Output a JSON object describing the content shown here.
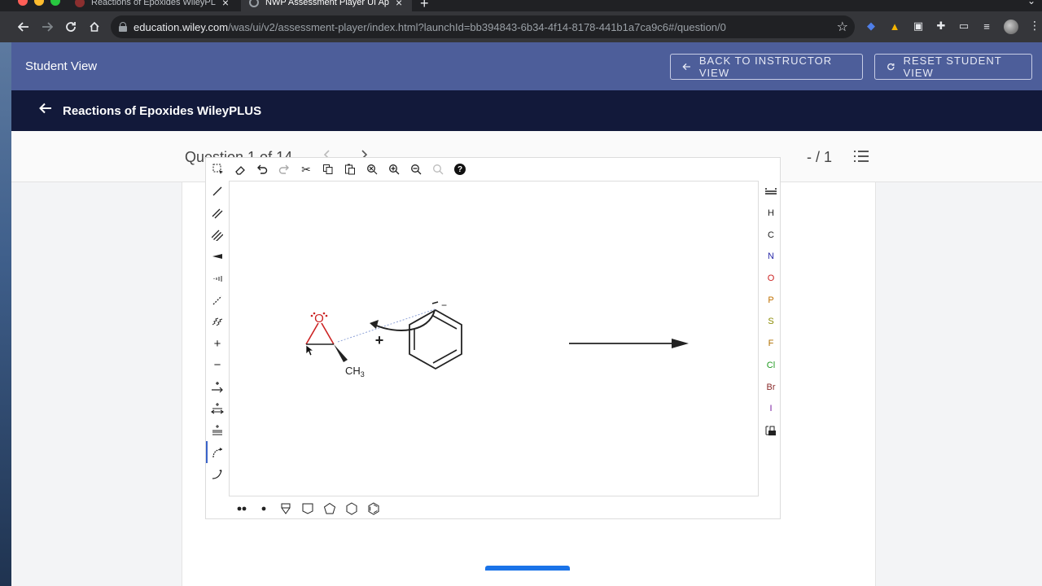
{
  "browser": {
    "tabs": [
      {
        "title": "Reactions of Epoxides WileyPL",
        "active": false
      },
      {
        "title": "NWP Assessment Player UI Ap",
        "active": true
      }
    ],
    "url_host": "education.wiley.com",
    "url_path": "/was/ui/v2/assessment-player/index.html?launchId=bb394843-6b34-4f14-8178-441b1a7ca9c6#/question/0"
  },
  "header": {
    "title": "Student View",
    "back_to_instructor": "BACK TO INSTRUCTOR VIEW",
    "reset_student": "RESET STUDENT VIEW"
  },
  "course": {
    "title": "Reactions of Epoxides WileyPLUS"
  },
  "question_nav": {
    "label": "Question 1 of 14",
    "score": "- / 1"
  },
  "editor": {
    "elements": [
      "H",
      "C",
      "N",
      "O",
      "P",
      "S",
      "F",
      "Cl",
      "Br",
      "I"
    ],
    "element_colors": {
      "H": "#222222",
      "C": "#222222",
      "N": "#2b2baa",
      "O": "#cc2222",
      "P": "#c07000",
      "S": "#8a8a00",
      "F": "#b07000",
      "Cl": "#1f9a1f",
      "Br": "#8a2a2a",
      "I": "#7a1fa0"
    },
    "molecule": {
      "oxygen_label": "O",
      "methyl_label": "CH",
      "methyl_subscript": "3",
      "plus_sign": "+",
      "carbanion_charge": "−"
    }
  },
  "colors": {
    "header_bg": "#4d5e9a",
    "nav_bg": "#12193a",
    "accent": "#1a73e8"
  }
}
